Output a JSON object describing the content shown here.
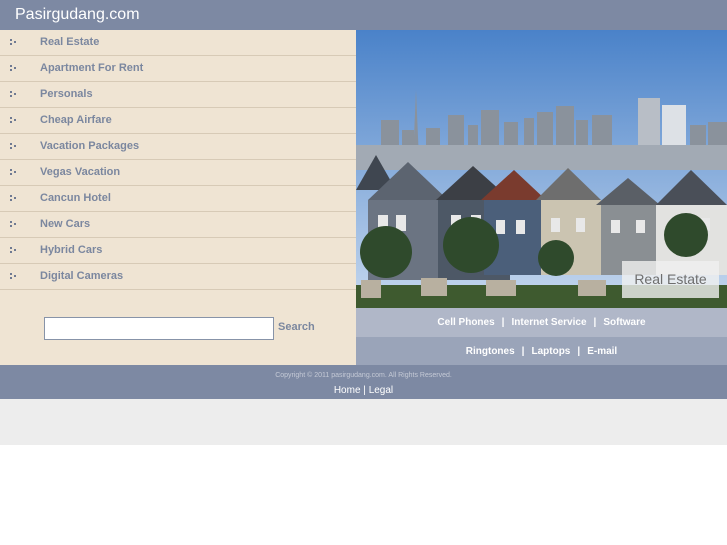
{
  "site": {
    "title": "Pasirgudang.com"
  },
  "menu": {
    "items": [
      {
        "label": "Real Estate"
      },
      {
        "label": "Apartment For Rent"
      },
      {
        "label": "Personals"
      },
      {
        "label": "Cheap Airfare"
      },
      {
        "label": "Vacation Packages"
      },
      {
        "label": "Vegas Vacation"
      },
      {
        "label": "Cancun Hotel"
      },
      {
        "label": "New Cars"
      },
      {
        "label": "Hybrid Cars"
      },
      {
        "label": "Digital Cameras"
      }
    ]
  },
  "search": {
    "value": "",
    "button_label": "Search"
  },
  "photo": {
    "label": "Real Estate"
  },
  "links_row1": [
    "Cell Phones",
    "Internet Service",
    "Software"
  ],
  "links_row2": [
    "Ringtones",
    "Laptops",
    "E-mail"
  ],
  "links_separator": "|",
  "footer": {
    "copyright": "Copyright © 2011 pasirgudang.com. All Rights Reserved.",
    "home_label": "Home",
    "separator": "|",
    "legal_label": "Legal"
  },
  "colors": {
    "header": "#7d89a3",
    "sidebar": "#efe4d3",
    "link_text": "#7b879f"
  }
}
